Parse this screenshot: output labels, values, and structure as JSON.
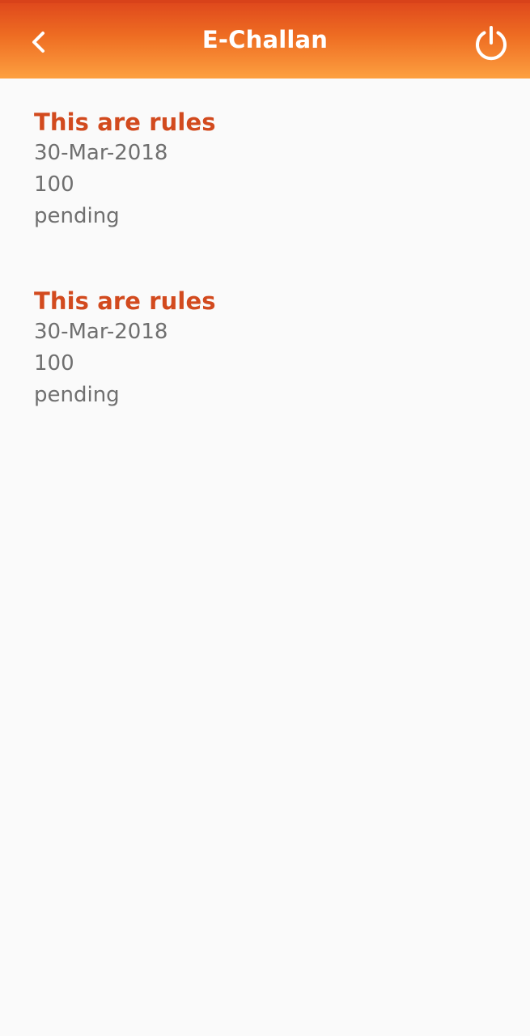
{
  "header": {
    "title": "E-Challan",
    "back_icon": "chevron-left-icon",
    "power_icon": "power-icon",
    "colors": {
      "gradient_top": "#de461c",
      "gradient_bottom": "#fda040",
      "text": "#ffffff"
    }
  },
  "challans": [
    {
      "title": "This are rules",
      "date": "30-Mar-2018",
      "amount": "100",
      "status": "pending"
    },
    {
      "title": "This are rules",
      "date": "30-Mar-2018",
      "amount": "100",
      "status": "pending"
    }
  ],
  "colors": {
    "item_title": "#d24a1e",
    "item_text": "#6f6f6f",
    "background": "#fafafa"
  }
}
